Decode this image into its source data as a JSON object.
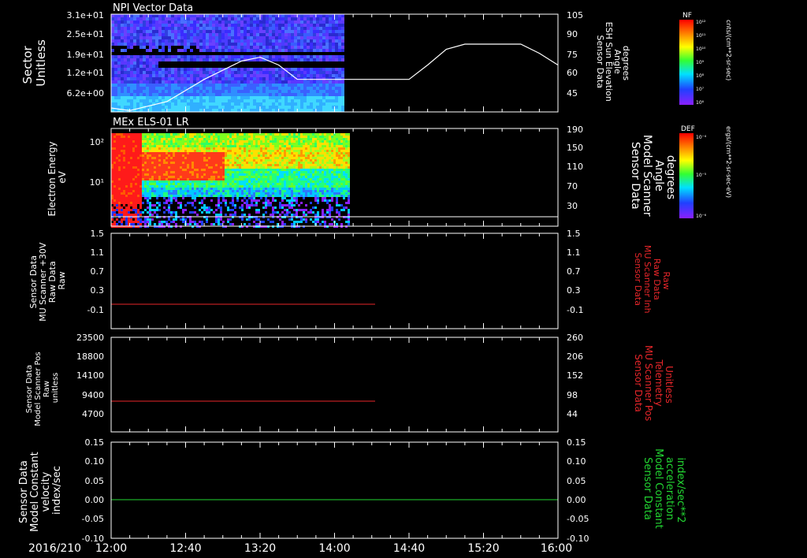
{
  "date_label": "2016/210",
  "x_ticks": [
    "12:00",
    "12:40",
    "13:20",
    "14:00",
    "14:40",
    "15:20",
    "16:00"
  ],
  "panels": [
    {
      "title": "NPI Vector Data",
      "left_label": [
        "Sector",
        "Unitless"
      ],
      "left_ticks": [
        "3.1e+01",
        "2.5e+01",
        "1.9e+01",
        "1.2e+01",
        "6.2e+00"
      ],
      "right_label": [
        "Sensor Data",
        "ESH Sun Elevation",
        "Angle",
        "degrees"
      ],
      "right_ticks": [
        "105",
        "90",
        "75",
        "60",
        "45"
      ],
      "colorbar": {
        "title": "NF",
        "unit": "cnts/(cm**2-sr-sec)",
        "ticks": [
          "10¹²",
          "10¹¹",
          "10¹⁰",
          "10⁹",
          "10⁸",
          "10⁷",
          "10⁶"
        ]
      }
    },
    {
      "title": "MEx ELS-01 LR",
      "left_label": [
        "Electron Energy",
        "eV"
      ],
      "left_ticks": [
        "10²",
        "10¹"
      ],
      "right_label": [
        "Sensor Data",
        "Model Scanner",
        "Angle",
        "degrees"
      ],
      "right_ticks": [
        "190",
        "150",
        "110",
        "70",
        "30"
      ],
      "colorbar": {
        "title": "DEF",
        "unit": "ergs/(cm**2-sr-sec-eV)",
        "ticks": [
          "10⁻⁴",
          "10⁻⁵",
          "10⁻⁶"
        ]
      }
    },
    {
      "left_label": [
        "Sensor Data",
        "MU Scanner +30V",
        "Raw Data",
        "Raw"
      ],
      "left_ticks": [
        "1.5",
        "1.1",
        "0.7",
        "0.3",
        "-0.1"
      ],
      "right_label": [
        "Sensor Data",
        "MU Scanner Inh",
        "Raw Data",
        "Raw"
      ],
      "right_ticks": [
        "1.5",
        "1.1",
        "0.7",
        "0.3",
        "-0.1"
      ]
    },
    {
      "left_label": [
        "Sensor Data",
        "Model Scanner Pos",
        "Raw",
        "unitless"
      ],
      "left_ticks": [
        "23500",
        "18800",
        "14100",
        "9400",
        "4700"
      ],
      "right_label": [
        "Sensor Data",
        "MU Scanner Pos",
        "Telemetry",
        "Unitless"
      ],
      "right_ticks": [
        "260",
        "206",
        "152",
        "98",
        "44"
      ]
    },
    {
      "left_label": [
        "Sensor Data",
        "Model Constant",
        "velocity",
        "index/sec"
      ],
      "left_ticks": [
        "0.15",
        "0.10",
        "0.05",
        "0.00",
        "-0.05",
        "-0.10"
      ],
      "right_label": [
        "Sensor Data",
        "Model Constant",
        "acceleration",
        "index/sec**2"
      ],
      "right_ticks": [
        "0.15",
        "0.10",
        "0.05",
        "0.00",
        "-0.05",
        "-0.10"
      ]
    }
  ],
  "chart_data": [
    {
      "type": "heatmap",
      "title": "NPI Vector Data",
      "x_range": [
        "12:00",
        "16:00"
      ],
      "ylabel": "Sector Unitless",
      "ylim": [
        0,
        31
      ],
      "data_end": "14:05",
      "overlay_series": {
        "name": "Sensor Data ESH Sun Elevation Angle",
        "y2lim": [
          30,
          105
        ],
        "x": [
          "12:00",
          "12:10",
          "12:30",
          "12:50",
          "13:10",
          "13:20",
          "13:30",
          "13:40",
          "14:00",
          "14:40",
          "14:50",
          "15:00",
          "15:10",
          "15:20",
          "15:40",
          "15:50",
          "16:00"
        ],
        "y": [
          33,
          31,
          38,
          55,
          69,
          72,
          66,
          55,
          55,
          55,
          66,
          78,
          82,
          82,
          82,
          75,
          66
        ]
      }
    },
    {
      "type": "heatmap",
      "title": "MEx ELS-01 LR",
      "x_range": [
        "12:00",
        "16:00"
      ],
      "ylabel": "Electron Energy eV",
      "ylog": true,
      "ylim": [
        1,
        200
      ],
      "data_end": "14:07",
      "overlay_series": {
        "name": "Sensor Data Model Scanner Angle",
        "y2lim": [
          0,
          190
        ],
        "constant": 7
      }
    },
    {
      "type": "line",
      "x": [
        "12:00",
        "14:20"
      ],
      "series": [
        {
          "name": "Sensor Data MU Scanner Inh Raw Data",
          "color": "#e8262a",
          "values": [
            0,
            0
          ]
        }
      ],
      "ylim": [
        -0.3,
        1.5
      ]
    },
    {
      "type": "line",
      "x": [
        "12:00",
        "14:20"
      ],
      "series": [
        {
          "name": "Sensor Data MU Scanner Pos Telemetry",
          "color": "#e8262a",
          "values": [
            86,
            86
          ]
        }
      ],
      "ylim": [
        0,
        260
      ]
    },
    {
      "type": "line",
      "x": [
        "12:00",
        "16:00"
      ],
      "series": [
        {
          "name": "Sensor Data Model Constant acceleration",
          "color": "#22d632",
          "values": [
            0.0,
            0.0
          ]
        }
      ],
      "ylim": [
        -0.1,
        0.15
      ]
    }
  ],
  "colors": {
    "red_label": "#e8262a",
    "green_label": "#22d632",
    "axis": "#ffffff"
  }
}
